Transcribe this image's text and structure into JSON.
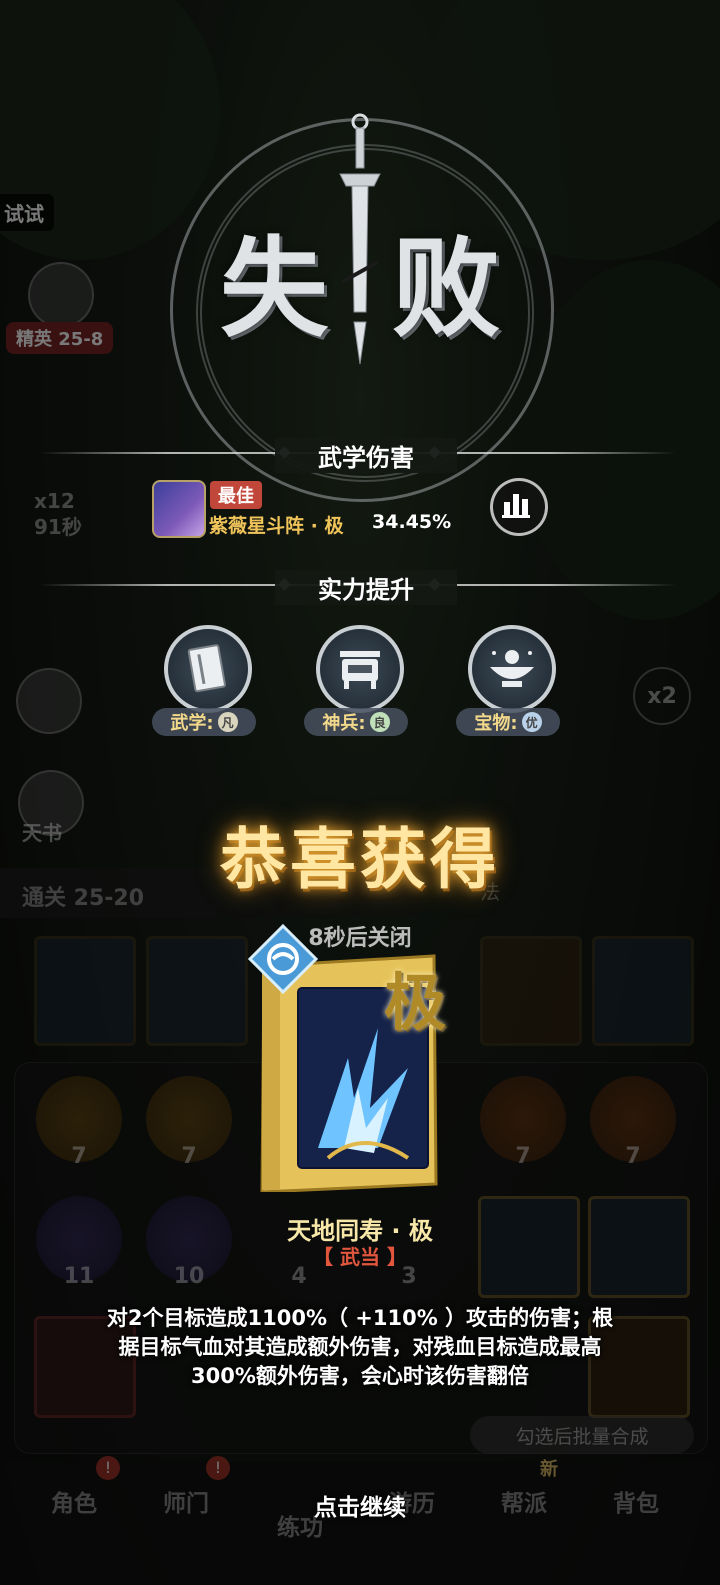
{
  "background": {
    "stage_tag": "试试",
    "elite_stage": "精英 25-8",
    "kill_count": "x12",
    "timer": "91秒",
    "speed": "x2",
    "tianshu": "天书",
    "clear_stage": "通关 25-20",
    "fa_label": "法",
    "orb_numbers": [
      "7",
      "7",
      "7",
      "7",
      "11",
      "10",
      "4",
      "3"
    ],
    "batch_label": "勾选后批量合成",
    "nav": [
      "角色",
      "师门",
      "练功",
      "游历",
      "帮派",
      "背包"
    ],
    "new_tag": "新",
    "badge_mark": "!"
  },
  "result": {
    "title_left": "失",
    "title_right": "败"
  },
  "damage_section": {
    "title": "武学伤害",
    "best_tag": "最佳",
    "skill_name": "紫薇星斗阵 · 极",
    "skill_percent": "34.45%"
  },
  "power_section": {
    "title": "实力提升",
    "items": [
      {
        "label": "武学:",
        "grade": "凡",
        "icon": "book-icon"
      },
      {
        "label": "神兵:",
        "grade": "良",
        "icon": "cauldron-icon"
      },
      {
        "label": "宝物:",
        "grade": "优",
        "icon": "treasure-bowl-icon"
      }
    ]
  },
  "reward": {
    "congrats": "恭喜获得",
    "close_hint": "8秒后关闭",
    "rarity": "极",
    "name": "天地同寿 · 极",
    "sect": "【 武当 】",
    "description_lines": [
      "对2个目标造成1100%（ +110% ）攻击的伤害；根",
      "据目标气血对其造成额外伤害，对残血目标造成最高",
      "300%额外伤害，会心时该伤害翻倍"
    ],
    "continue": "点击继续"
  },
  "colors": {
    "gold_text": "#f0c45a",
    "best_red": "#c2473b",
    "sect_red": "#e3563e",
    "book_gold": "#e6c35a"
  }
}
